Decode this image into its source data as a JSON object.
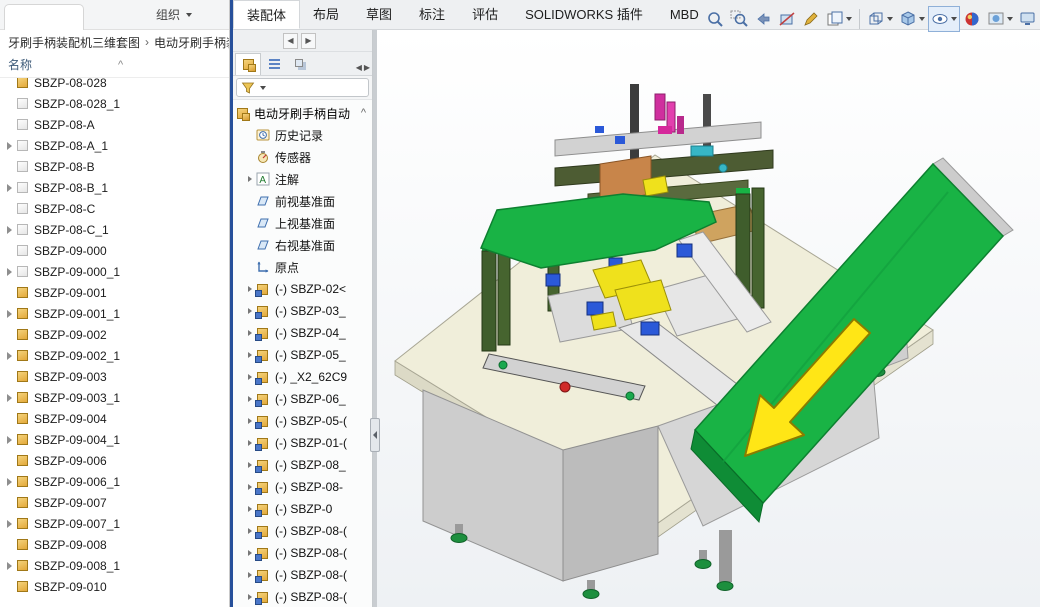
{
  "explorer": {
    "organize_label": "组织",
    "breadcrumb": {
      "part1": "牙刷手柄装配机三维套图",
      "separator": "›",
      "part2": "电动牙刷手柄装"
    },
    "name_column_header": "名称",
    "sort_indicator": "^",
    "files": [
      {
        "label": "SBZP-08-028"
      },
      {
        "label": "SBZP-08-028_1"
      },
      {
        "label": "SBZP-08-A"
      },
      {
        "label": "SBZP-08-A_1"
      },
      {
        "label": "SBZP-08-B"
      },
      {
        "label": "SBZP-08-B_1"
      },
      {
        "label": "SBZP-08-C"
      },
      {
        "label": "SBZP-08-C_1"
      },
      {
        "label": "SBZP-09-000"
      },
      {
        "label": "SBZP-09-000_1"
      },
      {
        "label": "SBZP-09-001"
      },
      {
        "label": "SBZP-09-001_1"
      },
      {
        "label": "SBZP-09-002"
      },
      {
        "label": "SBZP-09-002_1"
      },
      {
        "label": "SBZP-09-003"
      },
      {
        "label": "SBZP-09-003_1"
      },
      {
        "label": "SBZP-09-004"
      },
      {
        "label": "SBZP-09-004_1"
      },
      {
        "label": "SBZP-09-006"
      },
      {
        "label": "SBZP-09-006_1"
      },
      {
        "label": "SBZP-09-007"
      },
      {
        "label": "SBZP-09-007_1"
      },
      {
        "label": "SBZP-09-008"
      },
      {
        "label": "SBZP-09-008_1"
      },
      {
        "label": "SBZP-09-010"
      }
    ]
  },
  "ribbon": {
    "tabs": [
      {
        "label": "装配体"
      },
      {
        "label": "布局"
      },
      {
        "label": "草图"
      },
      {
        "label": "标注"
      },
      {
        "label": "评估"
      },
      {
        "label": "SOLIDWORKS 插件"
      },
      {
        "label": "MBD"
      }
    ],
    "active_tab": "装配体"
  },
  "feature_panel": {
    "nav_back": "◀",
    "nav_forward": "▶",
    "root_label": "电动牙刷手柄自动",
    "scroll_up_indicator": "^",
    "items": [
      {
        "label": "历史记录",
        "icon": "history-icon"
      },
      {
        "label": "传感器",
        "icon": "sensors-icon"
      },
      {
        "label": "注解",
        "icon": "annotations-icon"
      },
      {
        "label": "前视基准面",
        "icon": "plane-icon"
      },
      {
        "label": "上视基准面",
        "icon": "plane-icon"
      },
      {
        "label": "右视基准面",
        "icon": "plane-icon"
      },
      {
        "label": "原点",
        "icon": "origin-icon"
      },
      {
        "label": "(-) SBZP-02<",
        "icon": "component-icon"
      },
      {
        "label": "(-) SBZP-03_",
        "icon": "component-icon"
      },
      {
        "label": "(-) SBZP-04_",
        "icon": "component-icon"
      },
      {
        "label": "(-) SBZP-05_",
        "icon": "component-icon"
      },
      {
        "label": "(-) _X2_62C9",
        "icon": "component-icon"
      },
      {
        "label": "(-) SBZP-06_",
        "icon": "component-icon"
      },
      {
        "label": "(-) SBZP-05-(",
        "icon": "component-icon"
      },
      {
        "label": "(-) SBZP-01-(",
        "icon": "component-icon"
      },
      {
        "label": "(-) SBZP-08_",
        "icon": "component-icon"
      },
      {
        "label": "(-) SBZP-08-",
        "icon": "component-icon"
      },
      {
        "label": "(-) SBZP-0",
        "icon": "component-icon"
      },
      {
        "label": "(-) SBZP-08-(",
        "icon": "component-icon"
      },
      {
        "label": "(-) SBZP-08-(",
        "icon": "component-icon"
      },
      {
        "label": "(-) SBZP-08-(",
        "icon": "component-icon"
      },
      {
        "label": "(-) SBZP-08-(",
        "icon": "component-icon"
      }
    ]
  },
  "viewport": {
    "toolbar_icons": [
      "zoom-to-fit-icon",
      "zoom-to-area-icon",
      "previous-view-icon",
      "section-view-icon",
      "annotation-pencil-icon",
      "sheets-icon",
      "view-orientation-icon",
      "display-style-icon",
      "hide-show-items-icon",
      "edit-appearance-icon",
      "apply-scene-icon",
      "view-settings-icon"
    ],
    "colors": {
      "conveyor_green": "#19b345",
      "arrow_yellow": "#ffe616",
      "table_top_cream": "#f0eeda",
      "window_divider_blue": "#27509b"
    }
  }
}
